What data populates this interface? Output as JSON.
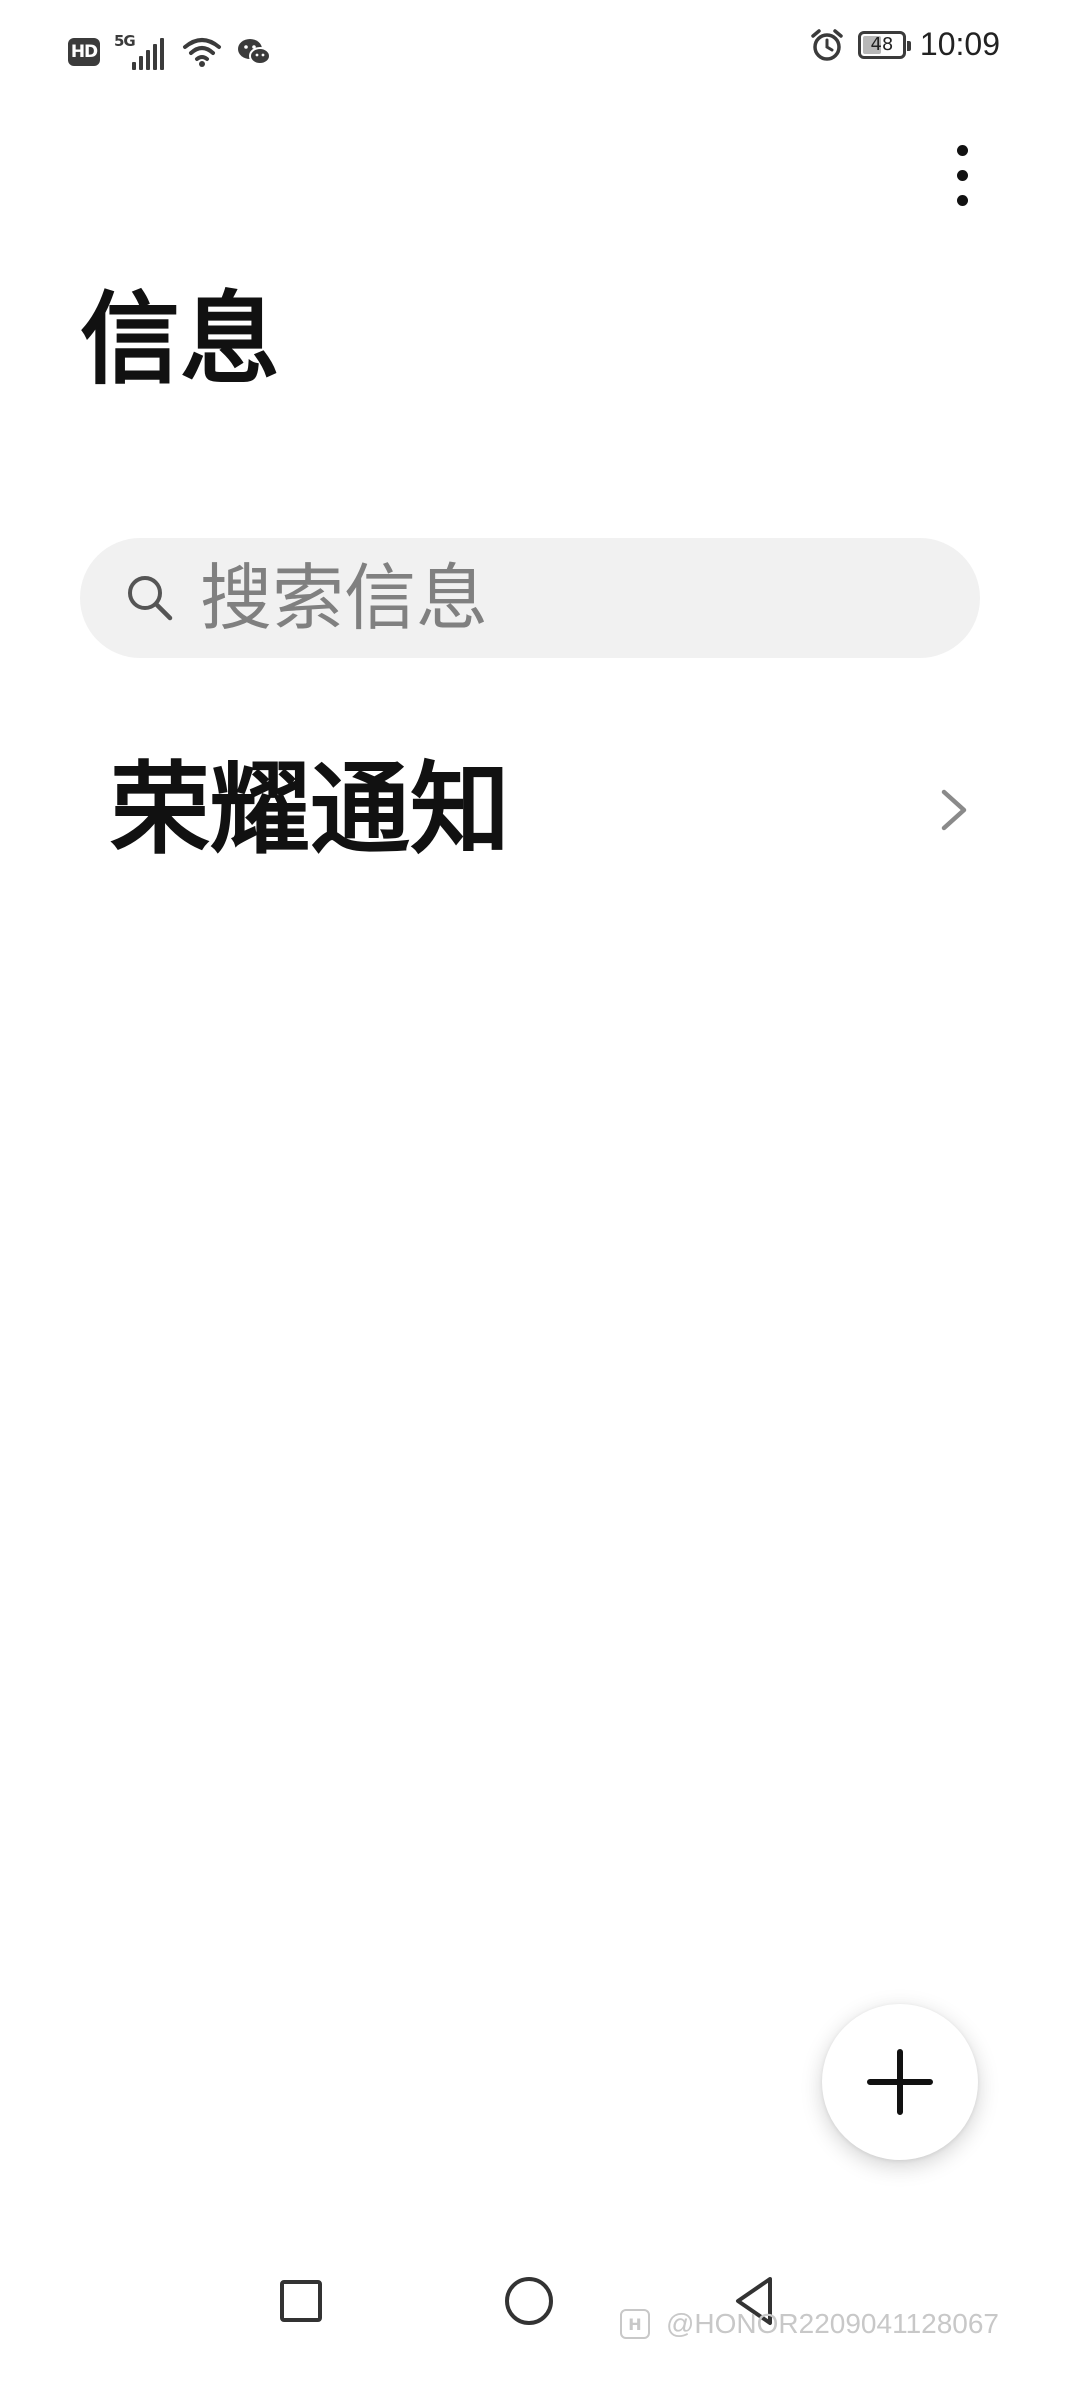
{
  "status_bar": {
    "hd_label": "HD",
    "network_label": "5G",
    "battery_level": "48",
    "battery_fraction": 0.48,
    "time": "10:09",
    "icons": [
      "hd-icon",
      "signal-icon",
      "wifi-icon",
      "wechat-icon",
      "alarm-icon",
      "battery-icon"
    ]
  },
  "header": {
    "title": "信息",
    "more_icon": "more-vertical-icon"
  },
  "search": {
    "placeholder": "搜索信息",
    "icon": "search-icon"
  },
  "list": {
    "items": [
      {
        "label": "荣耀通知",
        "icon": "chevron-right-icon"
      }
    ]
  },
  "fab": {
    "icon": "plus-icon"
  },
  "nav_bar": {
    "icons": [
      "recent-apps-icon",
      "home-icon",
      "back-icon"
    ]
  },
  "watermark": {
    "logo_text": "H",
    "text": "@HONOR2209041128067"
  },
  "colors": {
    "background": "#ffffff",
    "search_background": "#f1f1f1",
    "text_primary": "#111111",
    "text_secondary": "#808080"
  }
}
